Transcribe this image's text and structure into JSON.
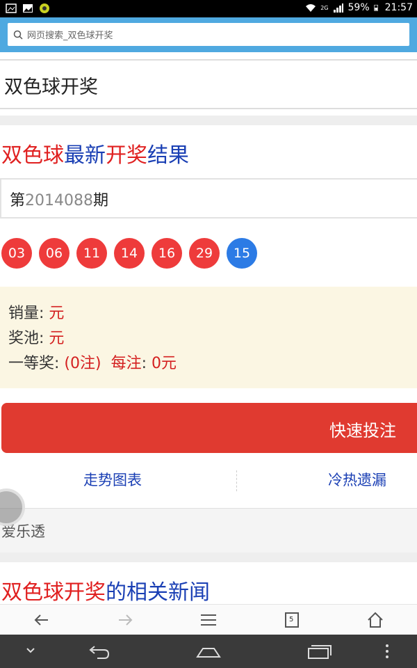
{
  "status_bar": {
    "battery": "59%",
    "time": "21:57",
    "network": "2G"
  },
  "search": {
    "placeholder": "网页搜索_双色球开奖"
  },
  "page_title": "双色球开奖",
  "result": {
    "heading_red1": "双色球",
    "heading_blue1": "最新",
    "heading_red2": "开奖",
    "heading_blue2": "结果",
    "issue_prefix": "第",
    "issue_number": "2014088",
    "issue_suffix": "期",
    "red_balls": [
      "03",
      "06",
      "11",
      "14",
      "16",
      "29"
    ],
    "blue_ball": "15"
  },
  "info": {
    "sales_label": "销量",
    "sales_value": "元",
    "pool_label": "奖池",
    "pool_value": "元",
    "first_label": "一等奖",
    "first_value": "(0注)",
    "per_label": "每注",
    "per_value": "0元"
  },
  "fast_bet_label": "快速投注",
  "links": {
    "trend": "走势图表",
    "hotcold": "冷热遗漏"
  },
  "aile_label": "爱乐透",
  "news": {
    "heading_red1": "双色球",
    "heading_red2": "开奖",
    "heading_blue": "的相关新闻"
  },
  "toolbar": {
    "tabs_count": "5"
  },
  "colors": {
    "accent_red": "#e02020",
    "accent_blue": "#1a3fb4",
    "search_bar": "#4fa9e0",
    "button_red": "#e03a30"
  }
}
